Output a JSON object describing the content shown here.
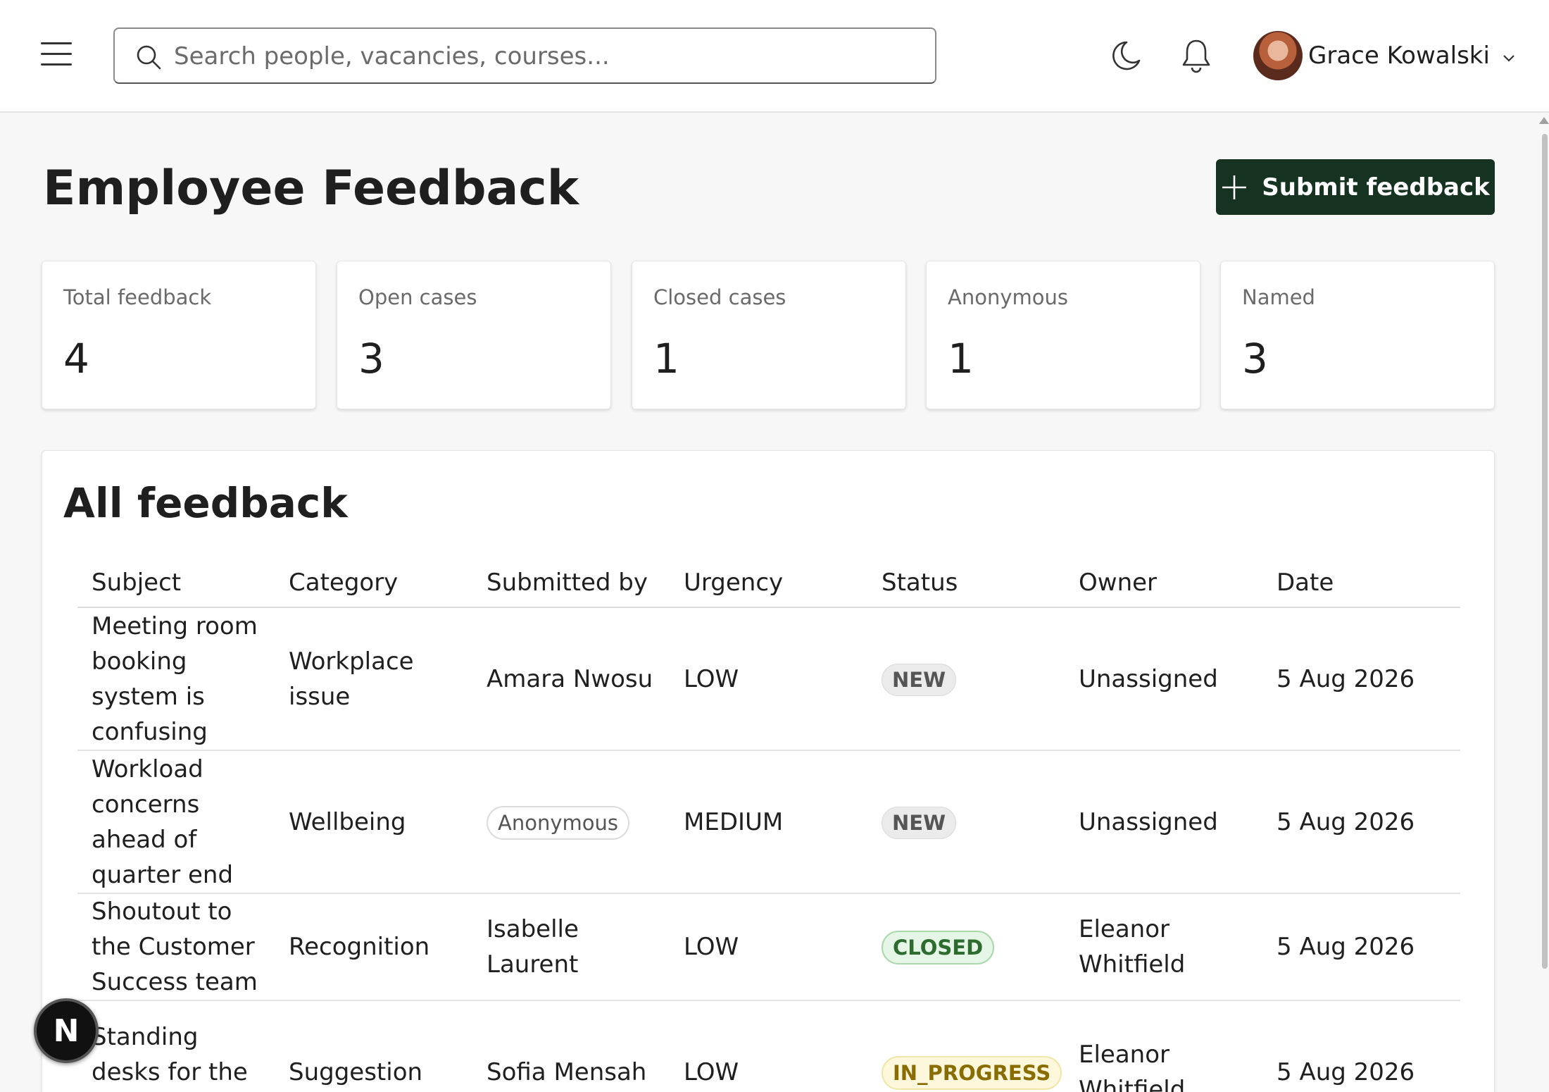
{
  "header": {
    "search_placeholder": "Search people, vacancies, courses...",
    "user_name": "Grace Kowalski"
  },
  "page": {
    "title": "Employee Feedback",
    "submit_label": "Submit feedback"
  },
  "stats": [
    {
      "label": "Total feedback",
      "value": "4"
    },
    {
      "label": "Open cases",
      "value": "3"
    },
    {
      "label": "Closed cases",
      "value": "1"
    },
    {
      "label": "Anonymous",
      "value": "1"
    },
    {
      "label": "Named",
      "value": "3"
    }
  ],
  "feedback": {
    "title": "All feedback",
    "columns": [
      "Subject",
      "Category",
      "Submitted by",
      "Urgency",
      "Status",
      "Owner",
      "Date"
    ],
    "rows": [
      {
        "subject": "Meeting room booking system is confusing",
        "category": "Workplace issue",
        "submitted_by": "Amara Nwosu",
        "urgency": "LOW",
        "status": "NEW",
        "owner": "Unassigned",
        "date": "5 Aug 2026"
      },
      {
        "subject": "Workload concerns ahead of quarter end",
        "category": "Wellbeing",
        "submitted_by": "Anonymous",
        "urgency": "MEDIUM",
        "status": "NEW",
        "owner": "Unassigned",
        "date": "5 Aug 2026"
      },
      {
        "subject": "Shoutout to the Customer Success team",
        "category": "Recognition",
        "submitted_by": "Isabelle Laurent",
        "urgency": "LOW",
        "status": "CLOSED",
        "owner": "Eleanor Whitfield",
        "date": "5 Aug 2026"
      },
      {
        "subject": "Standing desks for the engineering",
        "category": "Suggestion",
        "submitted_by": "Sofia Mensah",
        "urgency": "LOW",
        "status": "IN_PROGRESS",
        "owner": "Eleanor Whitfield",
        "date": "5 Aug 2026"
      }
    ]
  },
  "badge": {
    "letter": "N"
  }
}
